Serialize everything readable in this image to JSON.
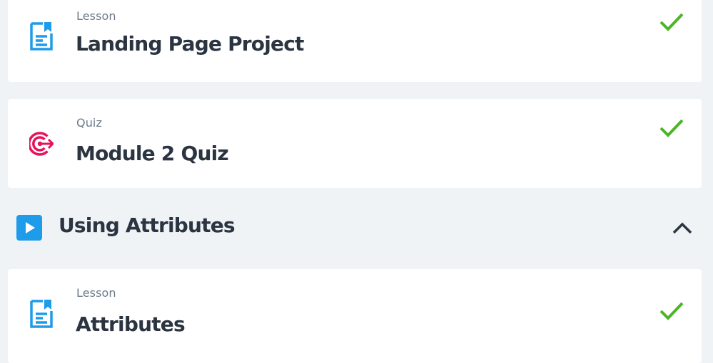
{
  "items": [
    {
      "type_label": "Lesson",
      "title": "Landing Page Project",
      "icon": "lesson-document-icon",
      "completed": true
    },
    {
      "type_label": "Quiz",
      "title": "Module 2 Quiz",
      "icon": "quiz-target-icon",
      "completed": true
    }
  ],
  "section": {
    "title": "Using Attributes",
    "icon": "play-icon",
    "expanded": true,
    "toggle_icon": "chevron-up-icon",
    "items": [
      {
        "type_label": "Lesson",
        "title": "Attributes",
        "icon": "lesson-document-icon",
        "completed": true
      }
    ]
  },
  "colors": {
    "background": "#f0f3f6",
    "card": "#ffffff",
    "title_text": "#2b3441",
    "type_text": "#6b7a8c",
    "lesson_icon": "#1e9be9",
    "quiz_icon": "#e8115a",
    "check": "#4cb527",
    "section_play": "#1e9be9"
  }
}
